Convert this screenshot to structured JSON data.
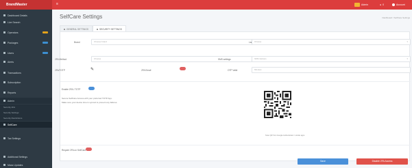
{
  "topbar": {
    "brand": "BrandMaster",
    "user_name": "Admin",
    "notification_count": "0",
    "account_label": "Account"
  },
  "sidebar": {
    "items": [
      {
        "label": "Dashboard Details",
        "badge_color": ""
      },
      {
        "label": "Live Search",
        "badge_color": ""
      },
      {
        "label": "Operators",
        "badge_color": "#e3a21a"
      },
      {
        "label": "Packages",
        "badge_color": "#3d8fd1"
      },
      {
        "label": "Users",
        "badge_color": "#3d8fd1"
      },
      {
        "label": "Alerts",
        "badge_color": ""
      },
      {
        "label": "Transactions",
        "badge_color": ""
      },
      {
        "label": "Subscription",
        "badge_color": ""
      },
      {
        "label": "Reports",
        "badge_color": ""
      },
      {
        "label": "Admin",
        "badge_color": ""
      }
    ],
    "submenu": [
      "Security 2FA",
      "Security Settings",
      "Security Restrictions"
    ],
    "current_item": "SelfCare",
    "lower_items": [
      "Tax Settings",
      "Additional Settings",
      "Mass Updates"
    ]
  },
  "page": {
    "title": "SelfCare Settings",
    "breadcrumb": "Dashboard / SelfCare Settings"
  },
  "tabs": [
    {
      "label": "GENERAL SETTINGS",
      "active": false
    },
    {
      "label": "SECURITY SETTINGS",
      "active": true
    }
  ],
  "form": {
    "brand_label": "Brand",
    "brand_value": "Choose brand",
    "language_label": "Language",
    "language_value": "Choose",
    "default_method_label": "2FA Method",
    "default_method_value": "Choose",
    "sms_settings_label": "SMS settings",
    "sms_settings_value": "SMS Options",
    "totp_label": "2FA/TOTP",
    "email_label": "2FA Email",
    "otp_label": "OTP Valid",
    "otp_value": "Minutes",
    "enable_totp_label": "Enable 2FA / TOTP",
    "totp_instructions": "Secure SelfCare Access with your preferred TOTP App.",
    "totp_instructions_2": "Make sure your device time is synced to prevent any failures.",
    "qr_caption": "Scan QR from Google Authenticator / similar apps",
    "require_2fa_label": "Require 2FA on SelfCare"
  },
  "buttons": {
    "save": "Save",
    "disable": "Disable 2FA Access"
  },
  "colors": {
    "topbar": "#dc3d3d",
    "sidebar": "#2e3a44",
    "toggle_off": "#e06060",
    "toggle_on": "#4a90d9",
    "save": "#4a90d9",
    "disable": "#e0524a"
  }
}
